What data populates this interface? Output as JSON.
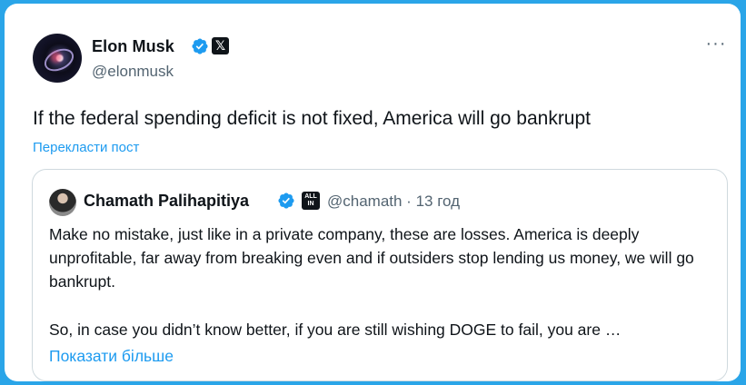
{
  "tweet": {
    "author_name": "Elon Musk",
    "handle": "@elonmusk",
    "text": "If the federal spending deficit is not fixed, America will go bankrupt",
    "translate_label": "Перекласти пост",
    "more_icon": "···"
  },
  "quote": {
    "author_name": "Chamath Palihapitiya",
    "badge_text": "ALL IN",
    "handle_time": "@chamath · 13 год",
    "paragraph1": "Make no mistake, just like in a private company, these are losses. America is deeply unprofitable, far away from breaking even and if outsiders stop lending us money, we will go bankrupt.",
    "paragraph2": "So, in case you didn’t know better, if you are still wishing DOGE to fail, you are …",
    "show_more_label": "Показати більше"
  },
  "colors": {
    "background": "#2aa5e8",
    "link": "#1d9bf0",
    "verified": "#1d9bf0",
    "secondary_text": "#536471"
  },
  "icons": [
    "verified-badge-icon",
    "x-logo-icon",
    "more-options-icon",
    "all-in-podcast-icon"
  ]
}
